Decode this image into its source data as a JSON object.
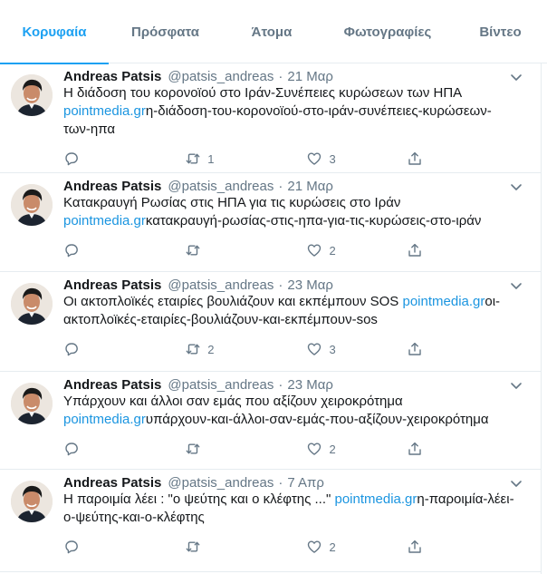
{
  "tabs": [
    {
      "label": "Κορυφαία",
      "active": true
    },
    {
      "label": "Πρόσφατα",
      "active": false
    },
    {
      "label": "Άτομα",
      "active": false
    },
    {
      "label": "Φωτογραφίες",
      "active": false
    },
    {
      "label": "Βίντεο",
      "active": false
    }
  ],
  "colors": {
    "accent": "#1da1f2",
    "link": "#1b95e0",
    "muted": "#657786"
  },
  "tweets": [
    {
      "name": "Andreas Patsis",
      "handle": "@patsis_andreas",
      "dot": "·",
      "time": "21 Μαρ",
      "text": "Η διάδοση του κορονοϊού στο Ιράν-Συνέπειες κυρώσεων των ΗΠΑ",
      "link": "pointmedia.gr",
      "link_suffix": "η-διάδοση-του-κορονοϊού-στο-ιράν-συνέπειες-κυρώσεων-των-ηπα",
      "replies": "",
      "retweets": "1",
      "likes": "3"
    },
    {
      "name": "Andreas Patsis",
      "handle": "@patsis_andreas",
      "dot": "·",
      "time": "21 Μαρ",
      "text": "Κατακραυγή Ρωσίας στις ΗΠΑ για τις κυρώσεις στο Ιράν",
      "link": "pointmedia.gr",
      "link_suffix": "κατακραυγή-ρωσίας-στις-ηπα-για-τις-κυρώσεις-στο-ιράν",
      "replies": "",
      "retweets": "",
      "likes": "2"
    },
    {
      "name": "Andreas Patsis",
      "handle": "@patsis_andreas",
      "dot": "·",
      "time": "23 Μαρ",
      "text": "Οι ακτοπλοϊκές εταιρίες βουλιάζουν και εκπέμπουν SOS",
      "link": "pointmedia.gr",
      "link_suffix": "οι-ακτοπλοϊκές-εταιρίες-βουλιάζουν-και-εκπέμπουν-sos",
      "replies": "",
      "retweets": "2",
      "likes": "3"
    },
    {
      "name": "Andreas Patsis",
      "handle": "@patsis_andreas",
      "dot": "·",
      "time": "23 Μαρ",
      "text": "Υπάρχουν και άλλοι σαν εμάς που αξίζουν χειροκρότημα",
      "link": "pointmedia.gr",
      "link_suffix": "υπάρχουν-και-άλλοι-σαν-εμάς-που-αξίζουν-χειροκρότημα",
      "replies": "",
      "retweets": "",
      "likes": "2"
    },
    {
      "name": "Andreas Patsis",
      "handle": "@patsis_andreas",
      "dot": "·",
      "time": "7 Απρ",
      "text": "Η παροιμία λέει : \"ο ψεύτης και ο κλέφτης ...\"",
      "link": "pointmedia.gr",
      "link_suffix": "η-παροιμία-λέει-ο-ψεύτης-και-ο-κλέφτης",
      "replies": "",
      "retweets": "",
      "likes": "2"
    }
  ],
  "icons": {
    "reply": "reply-icon",
    "retweet": "retweet-icon",
    "like": "heart-icon",
    "share": "share-icon",
    "caret": "chevron-down-icon"
  }
}
